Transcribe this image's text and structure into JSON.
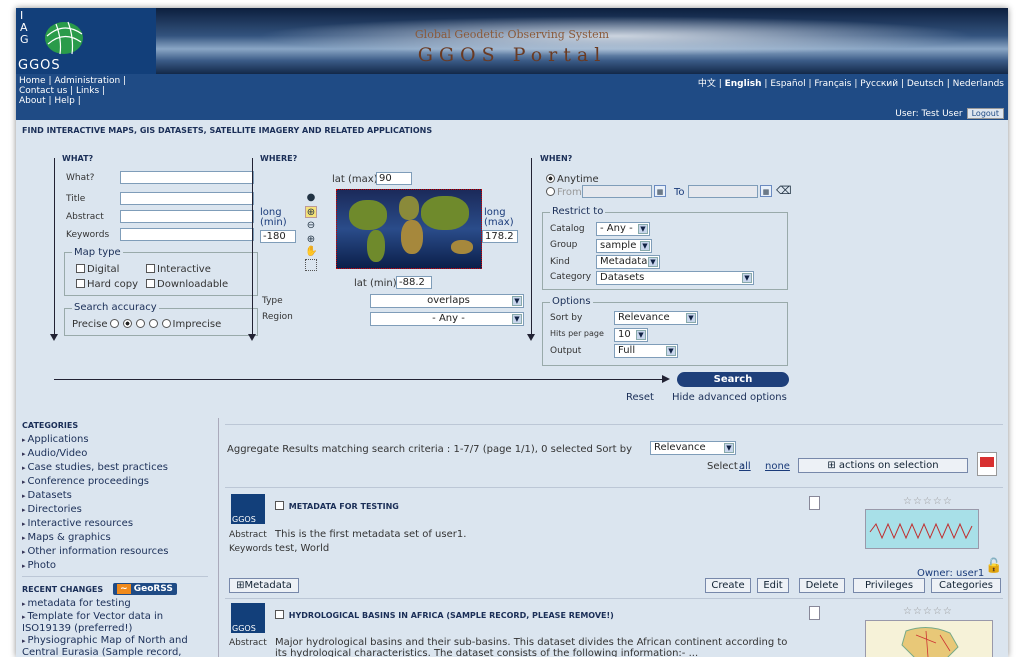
{
  "header": {
    "logo_text": "GGOS",
    "logo_mark": "I\nA\nG",
    "subtitle": "Global Geodetic Observing System",
    "title": "GGOS Portal"
  },
  "nav": {
    "links": [
      "Home | Administration |",
      "Contact us | Links |",
      "About | Help |"
    ],
    "languages": [
      "中文",
      "English",
      "Español",
      "Français",
      "Русский",
      "Deutsch",
      "Nederlands"
    ],
    "user": "User: Test User",
    "logout": "Logout"
  },
  "search": {
    "heading": "FIND INTERACTIVE MAPS, GIS DATASETS, SATELLITE IMAGERY AND RELATED APPLICATIONS",
    "what": {
      "legend": "WHAT?",
      "fields": [
        "What?",
        "Title",
        "Abstract",
        "Keywords"
      ],
      "map_type_legend": "Map type",
      "map_types": [
        "Digital",
        "Interactive",
        "Hard copy",
        "Downloadable"
      ],
      "accuracy_legend": "Search accuracy",
      "precise": "Precise",
      "imprecise": "Imprecise"
    },
    "where": {
      "legend": "WHERE?",
      "lat_max_label": "lat (max)",
      "lat_max": "90",
      "long_min_label": "long\n(min)",
      "long_min": "-180",
      "long_max_label": "long\n(max)",
      "long_max": "178.2",
      "lat_min_label": "lat (min)",
      "lat_min": "-88.2",
      "type_label": "Type",
      "type_value": "overlaps",
      "region_label": "Region",
      "region_value": "- Any -"
    },
    "when": {
      "legend": "WHEN?",
      "anytime": "Anytime",
      "from": "From",
      "to": "To",
      "restrict_legend": "Restrict to",
      "catalog_label": "Catalog",
      "catalog": "- Any -",
      "group_label": "Group",
      "group": "sample",
      "kind_label": "Kind",
      "kind": "Metadata",
      "category_label": "Category",
      "category": "Datasets",
      "options_legend": "Options",
      "sort_label": "Sort by",
      "sort": "Relevance",
      "hits_label": "Hits per page",
      "hits": "10",
      "output_label": "Output",
      "output": "Full"
    },
    "search_button": "Search",
    "reset": "Reset",
    "hide_advanced": "Hide advanced options"
  },
  "sidebar": {
    "categories_heading": "CATEGORIES",
    "categories": [
      "Applications",
      "Audio/Video",
      "Case studies, best practices",
      "Conference proceedings",
      "Datasets",
      "Directories",
      "Interactive resources",
      "Maps & graphics",
      "Other information resources",
      "Photo"
    ],
    "recent_heading": "RECENT CHANGES",
    "georss": "GeoRSS",
    "recent": [
      "metadata for testing",
      "Template for Vector data in ISO19139 (preferred!)",
      "Physiographic Map of North and Central Eurasia (Sample record,"
    ]
  },
  "results": {
    "summary": "Aggregate Results matching search criteria :  1-7/7  (page 1/1),  0 selected  Sort by",
    "sort_value": "Relevance",
    "select_label": "Select :",
    "select_all": "all",
    "select_none": "none",
    "actions": "actions on selection",
    "items": [
      {
        "title": "METADATA FOR TESTING",
        "abstract_label": "Abstract",
        "abstract": "This is the first metadata set of user1.",
        "keywords_label": "Keywords",
        "keywords": "test, World",
        "owner": "Owner: user1",
        "metadata_btn": "Metadata",
        "buttons": [
          "Create",
          "Edit",
          "Delete",
          "Privileges",
          "Categories"
        ]
      },
      {
        "title": "HYDROLOGICAL BASINS IN AFRICA (SAMPLE RECORD, PLEASE REMOVE!)",
        "abstract_label": "Abstract",
        "abstract": "Major hydrological basins and their sub-basins. This dataset divides the African continent according to its hydrological characteristics. The dataset consists of the following information:- ..."
      }
    ]
  }
}
